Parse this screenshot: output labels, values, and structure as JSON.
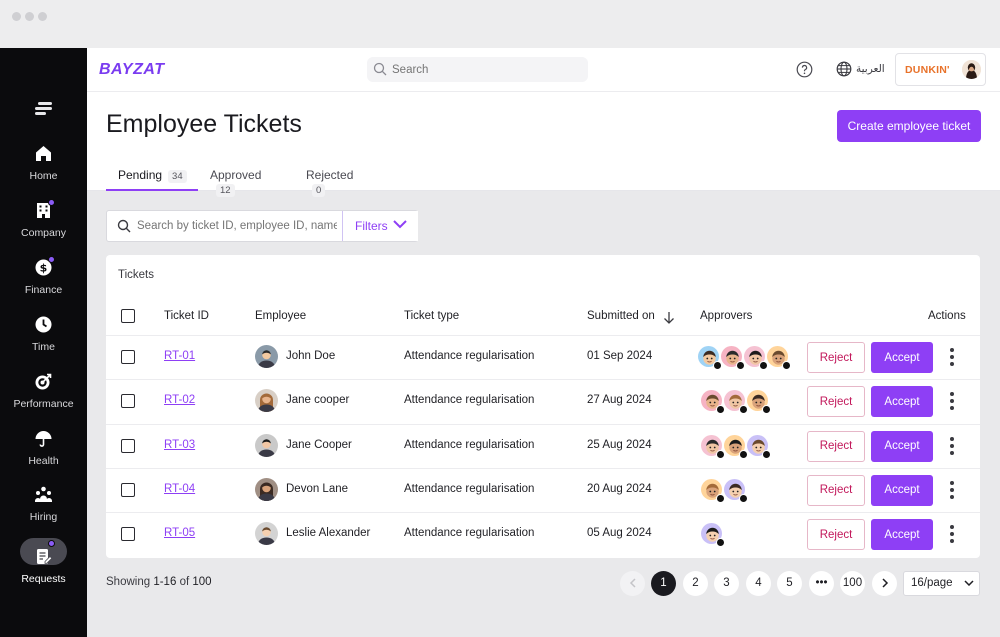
{
  "brand": "BAYZAT",
  "topbar": {
    "search_placeholder": "Search",
    "language": "العربية",
    "company": "DUNKIN'"
  },
  "sidebar": {
    "items": [
      {
        "label": "Home",
        "icon": "home-icon"
      },
      {
        "label": "Company",
        "icon": "building-icon",
        "badge": true
      },
      {
        "label": "Finance",
        "icon": "dollar-icon",
        "badge": true
      },
      {
        "label": "Time",
        "icon": "clock-icon"
      },
      {
        "label": "Performance",
        "icon": "target-icon"
      },
      {
        "label": "Health",
        "icon": "umbrella-icon"
      },
      {
        "label": "Hiring",
        "icon": "people-icon"
      },
      {
        "label": "Requests",
        "icon": "document-edit-icon",
        "active": true,
        "badge": true
      }
    ]
  },
  "page": {
    "title": "Employee Tickets",
    "create_button": "Create employee ticket"
  },
  "tabs": [
    {
      "label": "Pending",
      "count": "34",
      "active": true
    },
    {
      "label": "Approved",
      "count": "12"
    },
    {
      "label": "Rejected",
      "count": "0"
    }
  ],
  "filter": {
    "search_placeholder": "Search by ticket ID, employee ID, name",
    "filters_label": "Filters"
  },
  "table": {
    "title": "Tickets",
    "columns": {
      "ticket_id": "Ticket ID",
      "employee": "Employee",
      "ticket_type": "Ticket type",
      "submitted_on": "Submitted on",
      "approvers": "Approvers",
      "actions": "Actions"
    },
    "reject_label": "Reject",
    "accept_label": "Accept",
    "rows": [
      {
        "id": "RT-01",
        "employee": "John Doe",
        "type": "Attendance regularisation",
        "submitted": "01 Sep 2024",
        "approvers": 4
      },
      {
        "id": "RT-02",
        "employee": "Jane cooper",
        "type": "Attendance regularisation",
        "submitted": "27 Aug 2024",
        "approvers": 3
      },
      {
        "id": "RT-03",
        "employee": "Jane Cooper",
        "type": "Attendance regularisation",
        "submitted": "25 Aug 2024",
        "approvers": 3
      },
      {
        "id": "RT-04",
        "employee": "Devon Lane",
        "type": "Attendance regularisation",
        "submitted": "20 Aug 2024",
        "approvers": 2
      },
      {
        "id": "RT-05",
        "employee": "Leslie Alexander",
        "type": "Attendance regularisation",
        "submitted": "05 Aug 2024",
        "approvers": 1
      }
    ]
  },
  "pagination": {
    "showing_prefix": "Showing",
    "showing_range": "1-16",
    "showing_of": "of",
    "showing_total": "100",
    "pages": [
      "1",
      "2",
      "3",
      "4",
      "5",
      "•••",
      "100"
    ],
    "per_page": "16/page"
  },
  "colors": {
    "accent": "#8e3ff5",
    "reject": "#c2185b",
    "sidebar": "#0b0b0d"
  }
}
